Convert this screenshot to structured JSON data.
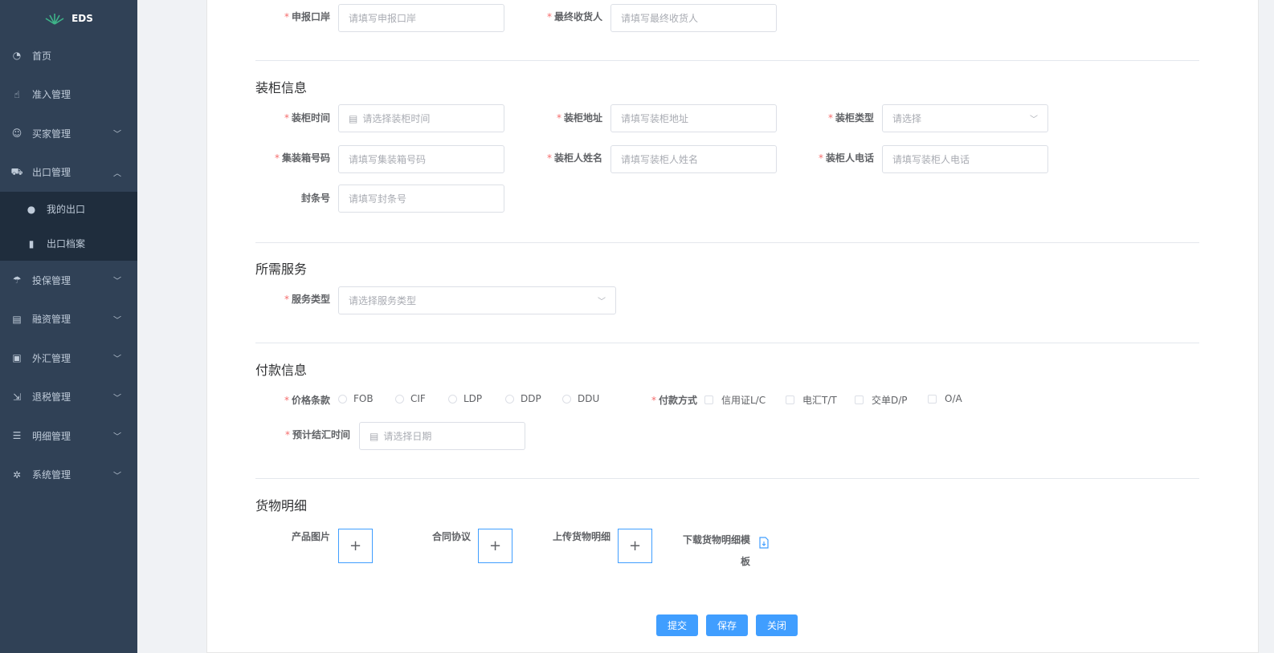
{
  "app": {
    "logo_text": "EDS"
  },
  "sidebar": {
    "items": [
      {
        "label": "首页",
        "icon": "dashboard-icon"
      },
      {
        "label": "准入管理",
        "icon": "hand-icon"
      },
      {
        "label": "买家管理",
        "icon": "user-icon"
      },
      {
        "label": "出口管理",
        "icon": "cart-icon"
      },
      {
        "label": "投保管理",
        "icon": "umbrella-icon"
      },
      {
        "label": "融资管理",
        "icon": "wallet-icon"
      },
      {
        "label": "外汇管理",
        "icon": "exchange-icon"
      },
      {
        "label": "退税管理",
        "icon": "refund-icon"
      },
      {
        "label": "明细管理",
        "icon": "list-icon"
      },
      {
        "label": "系统管理",
        "icon": "gear-icon"
      }
    ],
    "submenu": [
      {
        "label": "我的出口",
        "icon": "globe-icon"
      },
      {
        "label": "出口档案",
        "icon": "file-icon"
      }
    ]
  },
  "form": {
    "top": {
      "port_label": "申报口岸",
      "port_placeholder": "请填写申报口岸",
      "consignee_label": "最终收货人",
      "consignee_placeholder": "请填写最终收货人"
    },
    "container": {
      "title": "装柜信息",
      "time_label": "装柜时间",
      "time_placeholder": "请选择装柜时间",
      "address_label": "装柜地址",
      "address_placeholder": "请填写装柜地址",
      "type_label": "装柜类型",
      "type_placeholder": "请选择",
      "box_label": "集装箱号码",
      "box_placeholder": "请填写集装箱号码",
      "person_label": "装柜人姓名",
      "person_placeholder": "请填写装柜人姓名",
      "phone_label": "装柜人电话",
      "phone_placeholder": "请填写装柜人电话",
      "seal_label": "封条号",
      "seal_placeholder": "请填写封条号"
    },
    "service": {
      "title": "所需服务",
      "type_label": "服务类型",
      "type_placeholder": "请选择服务类型"
    },
    "payment": {
      "title": "付款信息",
      "price_label": "价格条款",
      "price_options": [
        "FOB",
        "CIF",
        "LDP",
        "DDP",
        "DDU"
      ],
      "method_label": "付款方式",
      "method_options": [
        "信用证L/C",
        "电汇T/T",
        "交单D/P",
        "O/A"
      ],
      "settle_label": "预计结汇时间",
      "settle_placeholder": "请选择日期"
    },
    "goods": {
      "title": "货物明细",
      "product_label": "产品图片",
      "contract_label": "合同协议",
      "upload_label": "上传货物明细",
      "download_label_1": "下载货物明细模",
      "download_label_2": "板",
      "plus": "+"
    },
    "buttons": {
      "submit": "提交",
      "save": "保存",
      "close": "关闭"
    }
  }
}
